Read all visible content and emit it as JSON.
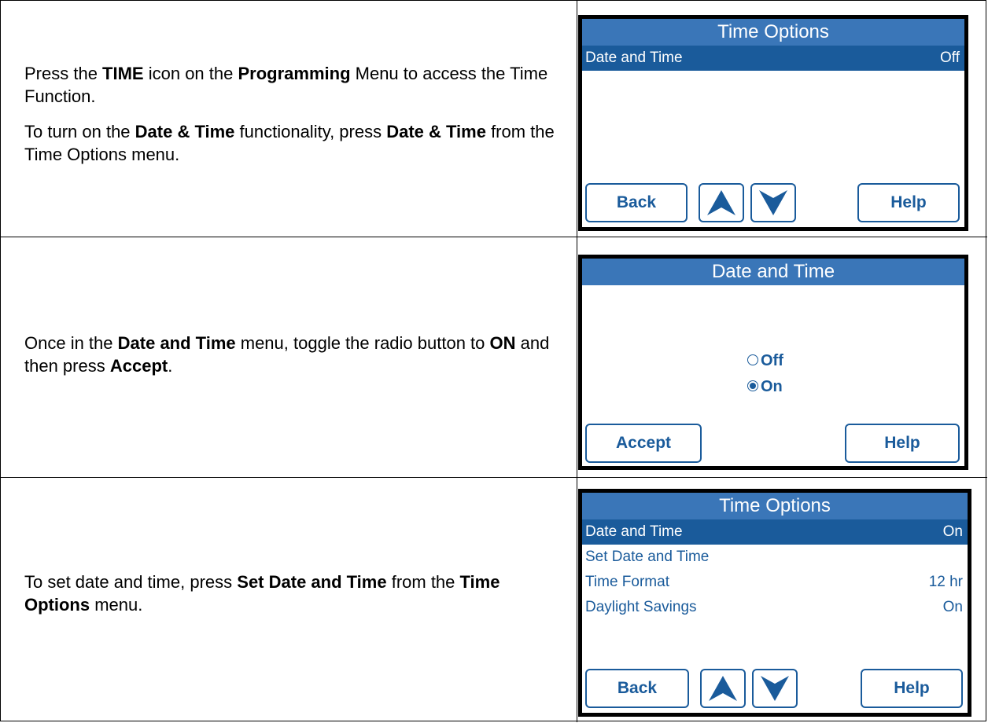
{
  "steps": [
    {
      "instruction_parts": [
        [
          {
            "t": "Press the "
          },
          {
            "t": "TIME",
            "b": true
          },
          {
            "t": " icon on the "
          },
          {
            "t": "Programming",
            "b": true
          },
          {
            "t": "  Menu to access the Time Function."
          }
        ],
        [
          {
            "t": "To turn on the "
          },
          {
            "t": "Date & Time",
            "b": true
          },
          {
            "t": " functionality, press "
          },
          {
            "t": "Date & Time",
            "b": true
          },
          {
            "t": " from the Time Options menu."
          }
        ]
      ],
      "screen": {
        "title": "Time Options",
        "rows": [
          {
            "label": "Date and Time",
            "value": "Off",
            "selected": true
          }
        ],
        "buttons": {
          "back": "Back",
          "help": "Help"
        }
      }
    },
    {
      "instruction_parts": [
        [
          {
            "t": "Once in the "
          },
          {
            "t": "Date and Time",
            "b": true
          },
          {
            "t": " menu, toggle the radio button to "
          },
          {
            "t": "ON",
            "b": true
          },
          {
            "t": " and then press "
          },
          {
            "t": "Accept",
            "b": true
          },
          {
            "t": "."
          }
        ]
      ],
      "screen": {
        "title": "Date and Time",
        "options": [
          {
            "label": "Off",
            "checked": false
          },
          {
            "label": "On",
            "checked": true
          }
        ],
        "buttons": {
          "accept": "Accept",
          "help": "Help"
        }
      }
    },
    {
      "instruction_parts": [
        [
          {
            "t": "To set date and time, press "
          },
          {
            "t": "Set Date and Time",
            "b": true
          },
          {
            "t": " from the "
          },
          {
            "t": "Time Options",
            "b": true
          },
          {
            "t": " menu."
          }
        ]
      ],
      "screen": {
        "title": "Time Options",
        "rows": [
          {
            "label": "Date and Time",
            "value": "On",
            "selected": true
          },
          {
            "label": "Set Date and Time",
            "value": "",
            "selected": false
          },
          {
            "label": "Time Format",
            "value": "12 hr",
            "selected": false
          },
          {
            "label": "Daylight Savings",
            "value": "On",
            "selected": false
          }
        ],
        "buttons": {
          "back": "Back",
          "help": "Help"
        }
      }
    }
  ],
  "colors": {
    "title_bar": "#3a76b8",
    "selected_row": "#1a5b9b",
    "accent": "#1a5b9b"
  },
  "icons": {
    "up": "up-arrow-icon",
    "down": "down-arrow-icon",
    "radio": "radio-button-icon"
  }
}
